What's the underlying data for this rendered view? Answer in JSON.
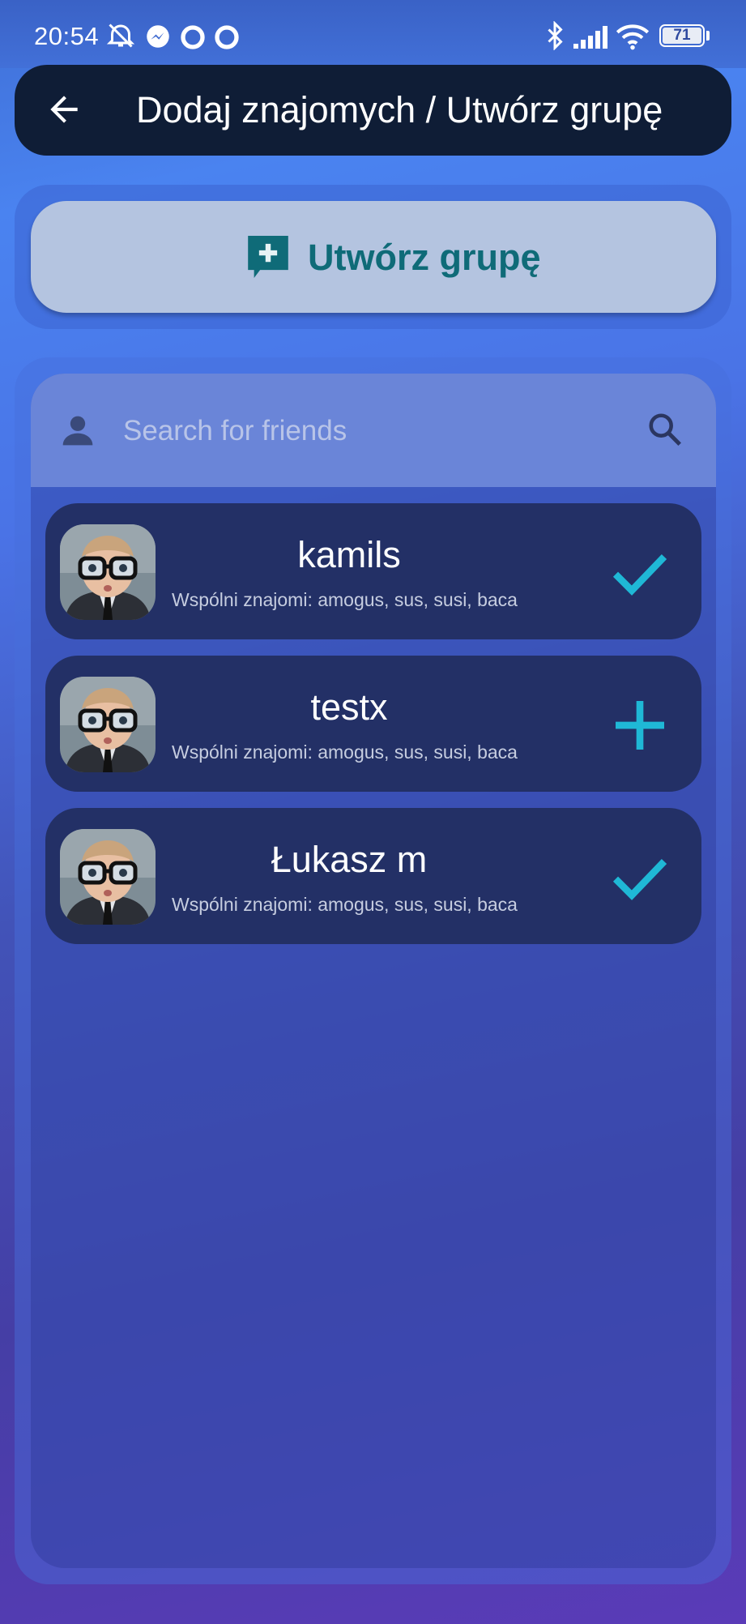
{
  "status_bar": {
    "time": "20:54",
    "battery": "71",
    "icons": [
      "alarm-off-icon",
      "messenger-icon",
      "circle-icon",
      "circle-icon",
      "bluetooth-icon",
      "signal-icon",
      "wifi-icon",
      "battery-icon"
    ]
  },
  "app_bar": {
    "title": "Dodaj znajomych / Utwórz grupę",
    "back_icon": "arrow-back-icon"
  },
  "create_group": {
    "label": "Utwórz grupę",
    "icon": "add-comment-icon",
    "color": "#0f6b78"
  },
  "search": {
    "placeholder": "Search for friends",
    "value": "",
    "left_icon": "person-icon",
    "right_icon": "search-icon"
  },
  "friends": [
    {
      "name": "kamils",
      "mutual": "Wspólni znajomi: amogus, sus, susi, baca",
      "action": "check-icon"
    },
    {
      "name": "testx",
      "mutual": "Wspólni znajomi: amogus, sus, susi, baca",
      "action": "plus-icon"
    },
    {
      "name": "Łukasz m",
      "mutual": "Wspólni znajomi: amogus, sus, susi, baca",
      "action": "check-icon"
    }
  ],
  "colors": {
    "accent": "#1fb8d6",
    "app_bar": "#0f1d36",
    "card": "#233066",
    "create_button": "#b4c4e0"
  }
}
